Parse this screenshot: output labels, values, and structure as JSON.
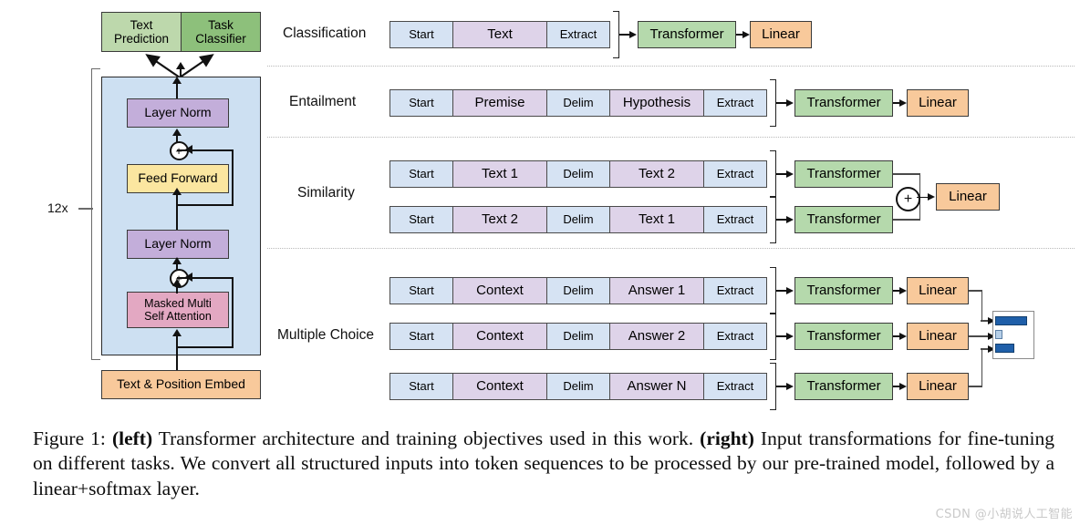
{
  "figure": {
    "caption_prefix": "Figure 1:",
    "caption_bold_left": "(left)",
    "caption_part1": " Transformer architecture and training objectives used in this work. ",
    "caption_bold_right": "(right)",
    "caption_part2": " Input transformations for fine-tuning on different tasks. We convert all structured inputs into token sequences to be processed by our pre-trained model, followed by a linear+softmax layer.",
    "watermark": "CSDN @小胡说人工智能"
  },
  "architecture": {
    "heads": [
      {
        "label": "Text\nPrediction",
        "color": "#bdd8ac"
      },
      {
        "label": "Task\nClassifier",
        "color": "#8dc07b"
      }
    ],
    "repeat_label": "12x",
    "blocks": [
      {
        "label": "Layer Norm",
        "color": "#c3aeda"
      },
      {
        "label": "Feed Forward",
        "color": "#fbe6a0"
      },
      {
        "label": "Layer Norm",
        "color": "#c3aeda"
      },
      {
        "label": "Masked Multi\nSelf Attention",
        "color": "#e3a8c2"
      }
    ],
    "add_nodes": [
      "+",
      "+"
    ],
    "embedding": {
      "label": "Text & Position Embed",
      "color": "#f8c99b"
    },
    "panel_color": "#cde0f2"
  },
  "colors": {
    "token_start": "#d6e3f3",
    "token_content": "#ded3e9",
    "transformer": "#b5d9ac",
    "linear": "#f8c99b",
    "bar_dark": "#1f5fa9",
    "bar_light": "#b6cfe8"
  },
  "tasks": [
    {
      "name": "Classification",
      "rows": [
        {
          "tokens": [
            {
              "text": "Start",
              "kind": "special"
            },
            {
              "text": "Text",
              "kind": "content"
            },
            {
              "text": "Extract",
              "kind": "special"
            }
          ],
          "transformer": "Transformer",
          "linear": "Linear"
        }
      ]
    },
    {
      "name": "Entailment",
      "rows": [
        {
          "tokens": [
            {
              "text": "Start",
              "kind": "special"
            },
            {
              "text": "Premise",
              "kind": "content"
            },
            {
              "text": "Delim",
              "kind": "special"
            },
            {
              "text": "Hypothesis",
              "kind": "content"
            },
            {
              "text": "Extract",
              "kind": "special"
            }
          ],
          "transformer": "Transformer",
          "linear": "Linear"
        }
      ]
    },
    {
      "name": "Similarity",
      "merge_node": "+",
      "linear": "Linear",
      "rows": [
        {
          "tokens": [
            {
              "text": "Start",
              "kind": "special"
            },
            {
              "text": "Text 1",
              "kind": "content"
            },
            {
              "text": "Delim",
              "kind": "special"
            },
            {
              "text": "Text 2",
              "kind": "content"
            },
            {
              "text": "Extract",
              "kind": "special"
            }
          ],
          "transformer": "Transformer"
        },
        {
          "tokens": [
            {
              "text": "Start",
              "kind": "special"
            },
            {
              "text": "Text 2",
              "kind": "content"
            },
            {
              "text": "Delim",
              "kind": "special"
            },
            {
              "text": "Text 1",
              "kind": "content"
            },
            {
              "text": "Extract",
              "kind": "special"
            }
          ],
          "transformer": "Transformer"
        }
      ]
    },
    {
      "name": "Multiple Choice",
      "rows": [
        {
          "tokens": [
            {
              "text": "Start",
              "kind": "special"
            },
            {
              "text": "Context",
              "kind": "content"
            },
            {
              "text": "Delim",
              "kind": "special"
            },
            {
              "text": "Answer 1",
              "kind": "content"
            },
            {
              "text": "Extract",
              "kind": "special"
            }
          ],
          "transformer": "Transformer",
          "linear": "Linear"
        },
        {
          "tokens": [
            {
              "text": "Start",
              "kind": "special"
            },
            {
              "text": "Context",
              "kind": "content"
            },
            {
              "text": "Delim",
              "kind": "special"
            },
            {
              "text": "Answer 2",
              "kind": "content"
            },
            {
              "text": "Extract",
              "kind": "special"
            }
          ],
          "transformer": "Transformer",
          "linear": "Linear"
        },
        {
          "tokens": [
            {
              "text": "Start",
              "kind": "special"
            },
            {
              "text": "Context",
              "kind": "content"
            },
            {
              "text": "Delim",
              "kind": "special"
            },
            {
              "text": "Answer N",
              "kind": "content"
            },
            {
              "text": "Extract",
              "kind": "special"
            }
          ],
          "transformer": "Transformer",
          "linear": "Linear"
        }
      ],
      "softmax_histogram": {
        "bars": [
          0.95,
          0.18,
          0.55
        ]
      }
    }
  ]
}
